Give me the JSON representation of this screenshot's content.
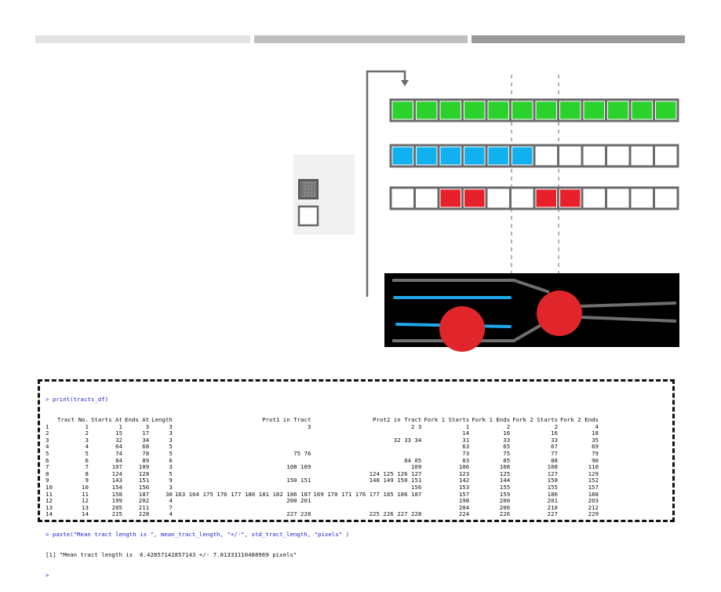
{
  "progress_bars": [
    {
      "color": "#e3e3e3"
    },
    {
      "color": "#c0c0c0"
    },
    {
      "color": "#9a9a9a"
    }
  ],
  "legend": {
    "filled_swatch_icon": "hatched-square-icon",
    "empty_swatch_icon": "empty-square-icon"
  },
  "tracks": [
    {
      "name": "green-track",
      "fill_color": "#2bd22b",
      "cells": [
        1,
        1,
        1,
        1,
        1,
        1,
        1,
        1,
        1,
        1,
        1,
        1
      ]
    },
    {
      "name": "blue-track",
      "fill_color": "#11b0ee",
      "cells": [
        1,
        1,
        1,
        1,
        1,
        1,
        0,
        0,
        0,
        0,
        0,
        0
      ]
    },
    {
      "name": "red-track",
      "fill_color": "#e8202a",
      "cells": [
        0,
        0,
        1,
        1,
        0,
        0,
        1,
        1,
        0,
        0,
        0,
        0
      ]
    }
  ],
  "colors": {
    "cell_border": "#6b6b6b",
    "fork_bg": "#000000",
    "fork_line": "#6f6f6f",
    "fork_blue": "#1ea7e8",
    "fork_red": "#e0262b",
    "dashed_line": "#9a9a9a"
  },
  "console": {
    "command1": "> print(tracts_df)",
    "headers": [
      "",
      "Tract No.",
      "Starts At",
      "Ends At",
      "Length",
      "Prot1 in Tract",
      "Prot2 in Tract",
      "Fork 1 Starts",
      "Fork 1 Ends",
      "Fork 2 Starts",
      "Fork 2 Ends"
    ],
    "rows": [
      [
        "1",
        "1",
        "1",
        "3",
        "3",
        "3",
        "2 3",
        "1",
        "2",
        "2",
        "4"
      ],
      [
        "2",
        "2",
        "15",
        "17",
        "3",
        "",
        "",
        "14",
        "16",
        "16",
        "18"
      ],
      [
        "3",
        "3",
        "32",
        "34",
        "3",
        "",
        "32 33 34",
        "31",
        "33",
        "33",
        "35"
      ],
      [
        "4",
        "4",
        "64",
        "68",
        "5",
        "",
        "",
        "63",
        "65",
        "67",
        "69"
      ],
      [
        "5",
        "5",
        "74",
        "78",
        "5",
        "75 76",
        "",
        "73",
        "75",
        "77",
        "79"
      ],
      [
        "6",
        "6",
        "84",
        "89",
        "6",
        "",
        "84 85",
        "83",
        "85",
        "88",
        "90"
      ],
      [
        "7",
        "7",
        "107",
        "109",
        "3",
        "108 109",
        "109",
        "106",
        "108",
        "108",
        "110"
      ],
      [
        "8",
        "8",
        "124",
        "128",
        "5",
        "",
        "124 125 126 127",
        "123",
        "125",
        "127",
        "129"
      ],
      [
        "9",
        "9",
        "143",
        "151",
        "9",
        "150 151",
        "148 149 150 151",
        "142",
        "144",
        "150",
        "152"
      ],
      [
        "10",
        "10",
        "154",
        "156",
        "3",
        "",
        "156",
        "153",
        "155",
        "155",
        "157"
      ],
      [
        "11",
        "11",
        "158",
        "187",
        "30",
        "163 164 175 176 177 180 181 182 186 187",
        "169 170 171 176 177 185 186 187",
        "157",
        "159",
        "186",
        "188"
      ],
      [
        "12",
        "12",
        "199",
        "202",
        "4",
        "200 201",
        "",
        "198",
        "200",
        "201",
        "203"
      ],
      [
        "13",
        "13",
        "205",
        "211",
        "7",
        "",
        "",
        "204",
        "206",
        "210",
        "212"
      ],
      [
        "14",
        "14",
        "225",
        "228",
        "4",
        "227 228",
        "225 226 227 228",
        "224",
        "226",
        "227",
        "229"
      ]
    ],
    "command2": "> paste(\"Mean tract length is \", mean_tract_length, \"+/-\", std_tract_length, \"pixels\" )",
    "result": "[1] \"Mean tract length is  6.42857142857143 +/- 7.01333110488969 pixels\"",
    "prompt": ">"
  }
}
